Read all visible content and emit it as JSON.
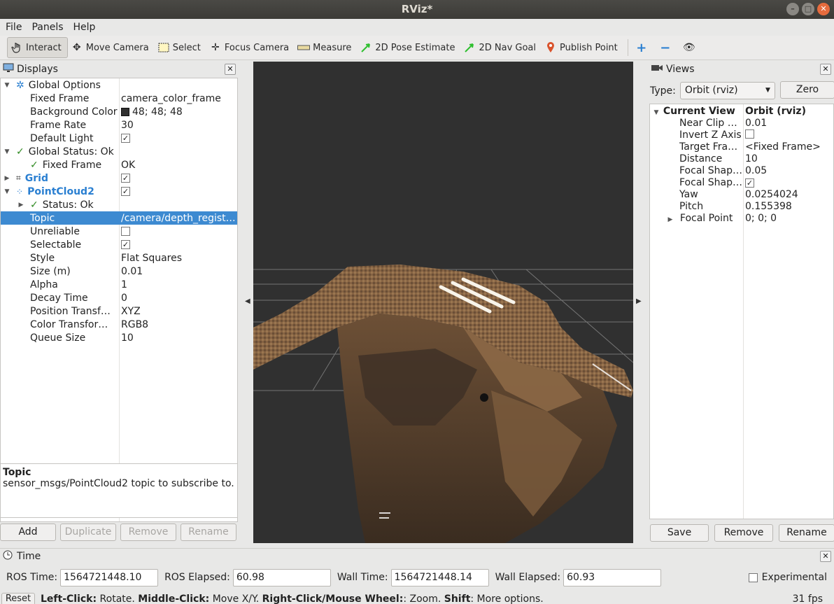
{
  "window": {
    "title": "RViz*"
  },
  "menu": [
    "File",
    "Panels",
    "Help"
  ],
  "toolbar": {
    "tools": [
      {
        "label": "Interact",
        "icon": "hand-pointer-icon",
        "active": true
      },
      {
        "label": "Move Camera",
        "icon": "move-arrows-icon"
      },
      {
        "label": "Select",
        "icon": "select-rect-icon"
      },
      {
        "label": "Focus Camera",
        "icon": "crosshair-icon"
      },
      {
        "label": "Measure",
        "icon": "ruler-icon"
      },
      {
        "label": "2D Pose Estimate",
        "icon": "green-arrow-icon"
      },
      {
        "label": "2D Nav Goal",
        "icon": "green-arrow-icon"
      },
      {
        "label": "Publish Point",
        "icon": "map-pin-icon"
      }
    ]
  },
  "displays": {
    "title": "Displays",
    "rows": [
      {
        "name": "Global Options",
        "value": ""
      },
      {
        "name": "Fixed Frame",
        "value": "camera_color_frame"
      },
      {
        "name": "Background Color",
        "value": "48; 48; 48"
      },
      {
        "name": "Frame Rate",
        "value": "30"
      },
      {
        "name": "Default Light",
        "value": ""
      },
      {
        "name": "Global Status: Ok",
        "value": ""
      },
      {
        "name": "Fixed Frame",
        "value": "OK"
      },
      {
        "name": "Grid",
        "value": ""
      },
      {
        "name": "PointCloud2",
        "value": ""
      },
      {
        "name": "Status: Ok",
        "value": ""
      },
      {
        "name": "Topic",
        "value": "/camera/depth_regist…"
      },
      {
        "name": "Unreliable",
        "value": ""
      },
      {
        "name": "Selectable",
        "value": ""
      },
      {
        "name": "Style",
        "value": "Flat Squares"
      },
      {
        "name": "Size (m)",
        "value": "0.01"
      },
      {
        "name": "Alpha",
        "value": "1"
      },
      {
        "name": "Decay Time",
        "value": "0"
      },
      {
        "name": "Position Transf…",
        "value": "XYZ"
      },
      {
        "name": "Color Transfor…",
        "value": "RGB8"
      },
      {
        "name": "Queue Size",
        "value": "10"
      }
    ],
    "description": {
      "title": "Topic",
      "text": "sensor_msgs/PointCloud2 topic to subscribe to."
    },
    "buttons": [
      "Add",
      "Duplicate",
      "Remove",
      "Rename"
    ]
  },
  "views": {
    "title": "Views",
    "type_label": "Type:",
    "type_value": "Orbit (rviz)",
    "zero_label": "Zero",
    "rows": [
      {
        "name": "Current View",
        "value": "Orbit (rviz)"
      },
      {
        "name": "Near Clip …",
        "value": "0.01"
      },
      {
        "name": "Invert Z Axis",
        "value": ""
      },
      {
        "name": "Target Fra…",
        "value": "<Fixed Frame>"
      },
      {
        "name": "Distance",
        "value": "10"
      },
      {
        "name": "Focal Shap…",
        "value": "0.05"
      },
      {
        "name": "Focal Shap…",
        "value": ""
      },
      {
        "name": "Yaw",
        "value": "0.0254024"
      },
      {
        "name": "Pitch",
        "value": "0.155398"
      },
      {
        "name": "Focal Point",
        "value": "0; 0; 0"
      }
    ],
    "buttons": [
      "Save",
      "Remove",
      "Rename"
    ]
  },
  "time": {
    "title": "Time",
    "ros_time_label": "ROS Time:",
    "ros_time": "1564721448.10",
    "ros_elapsed_label": "ROS Elapsed:",
    "ros_elapsed": "60.98",
    "wall_time_label": "Wall Time:",
    "wall_time": "1564721448.14",
    "wall_elapsed_label": "Wall Elapsed:",
    "wall_elapsed": "60.93",
    "experimental_label": "Experimental",
    "reset_label": "Reset",
    "status_parts": [
      {
        "b": "Left-Click:",
        "t": " Rotate. "
      },
      {
        "b": "Middle-Click:",
        "t": " Move X/Y. "
      },
      {
        "b": "Right-Click/Mouse Wheel:",
        "t": ": Zoom. "
      },
      {
        "b": "Shift",
        "t": ": More options."
      }
    ],
    "fps": "31 fps"
  },
  "colors": {
    "viewport_bg": "#303030",
    "selection": "#3d8ad1",
    "accent_blue": "#2a7fd1"
  }
}
